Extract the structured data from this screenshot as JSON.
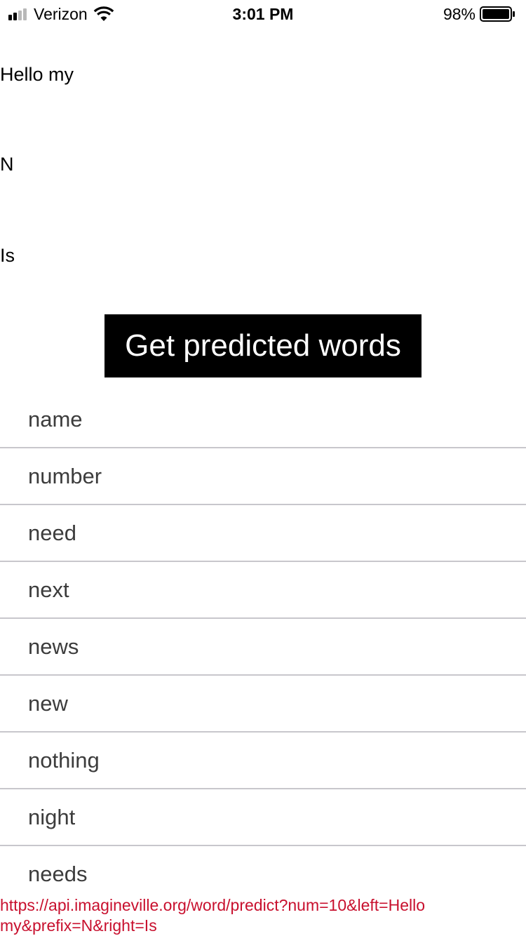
{
  "status_bar": {
    "carrier": "Verizon",
    "time": "3:01 PM",
    "battery_percent": "98%",
    "signal_bars_active": 2,
    "signal_bars_total": 4,
    "battery_level": 0.98,
    "icons": [
      "signal-icon",
      "wifi-icon",
      "battery-icon"
    ]
  },
  "fields": {
    "left": "Hello my",
    "prefix": "N",
    "right": "Is"
  },
  "button": {
    "label": "Get predicted words"
  },
  "predictions": [
    "name",
    "number",
    "need",
    "next",
    "news",
    "new",
    "nothing",
    "night",
    "needs"
  ],
  "request_url": "https://api.imagineville.org/word/predict?num=10&left=Hello my&prefix=N&right=Is",
  "colors": {
    "button_bg": "#000000",
    "button_text": "#ffffff",
    "url_text": "#c8102e",
    "separator": "#c8c7cc",
    "list_text": "#3c3c3c"
  }
}
